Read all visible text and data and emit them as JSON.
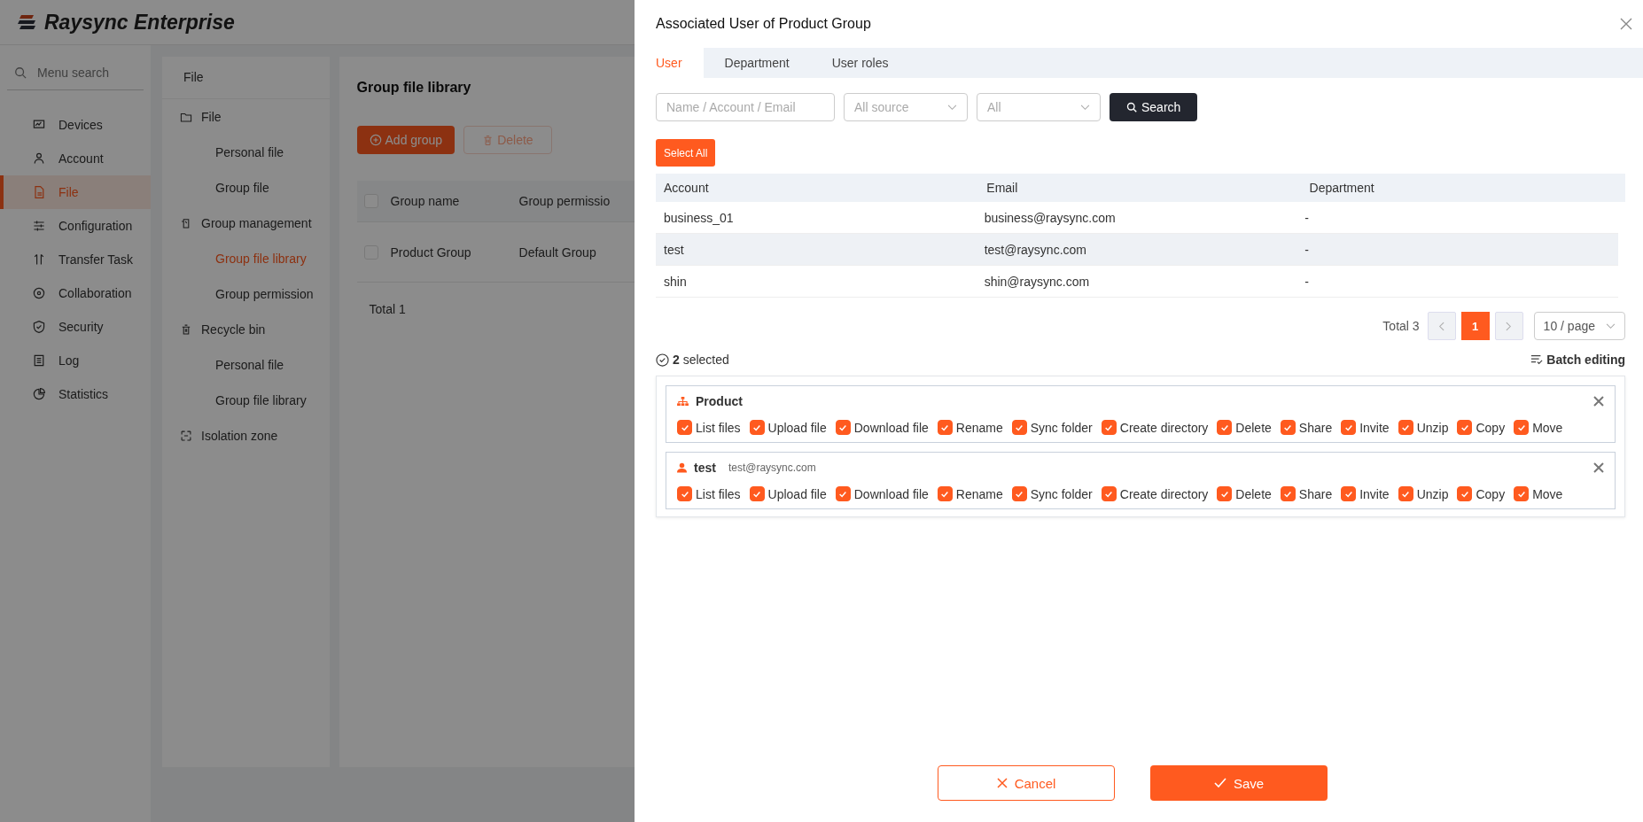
{
  "app": {
    "logo": "Raysync Enterprise",
    "menu_search": {
      "placeholder": "Menu search"
    },
    "menu": [
      {
        "label": "Devices",
        "selected": false
      },
      {
        "label": "Account",
        "selected": false
      },
      {
        "label": "File",
        "selected": true
      },
      {
        "label": "Configuration",
        "selected": false
      },
      {
        "label": "Transfer Task",
        "selected": false
      },
      {
        "label": "Collaboration",
        "selected": false
      },
      {
        "label": "Security",
        "selected": false
      },
      {
        "label": "Log",
        "selected": false
      },
      {
        "label": "Statistics",
        "selected": false
      }
    ],
    "subnav": {
      "title": "File",
      "groups": [
        {
          "label": "File",
          "children": [
            {
              "label": "Personal file",
              "selected": false
            },
            {
              "label": "Group file",
              "selected": false
            }
          ]
        },
        {
          "label": "Group management",
          "children": [
            {
              "label": "Group file library",
              "selected": true
            },
            {
              "label": "Group permission",
              "selected": false
            }
          ]
        },
        {
          "label": "Recycle bin",
          "children": [
            {
              "label": "Personal file",
              "selected": false
            },
            {
              "label": "Group file library",
              "selected": false
            }
          ]
        },
        {
          "label": "Isolation zone"
        }
      ]
    },
    "main": {
      "title": "Group file library",
      "buttons": [
        {
          "label": "Add group",
          "kind": "primary",
          "disabled": false
        },
        {
          "label": "Delete",
          "kind": "danger",
          "disabled": true
        }
      ],
      "table": {
        "header_checked": false,
        "columns": [
          "Group name",
          "Group permissio"
        ],
        "rows": [
          {
            "checked": false,
            "cells": [
              "Product Group",
              "Default Group"
            ]
          }
        ]
      },
      "total": "Total 1"
    }
  },
  "drawer": {
    "title": "Associated User of Product Group",
    "tabs": [
      {
        "label": "User",
        "selected": true
      },
      {
        "label": "Department",
        "selected": false
      },
      {
        "label": "User roles",
        "selected": false
      }
    ],
    "filters": {
      "search": {
        "placeholder": "Name / Account / Email"
      },
      "source": {
        "placeholder": "All source"
      },
      "status": {
        "placeholder": "All"
      },
      "search_button": "Search"
    },
    "select_all": "Select All",
    "table": {
      "columns": [
        "Account",
        "Email",
        "Department"
      ],
      "rows": [
        {
          "cells": [
            "business_01",
            "business@raysync.com",
            "-"
          ],
          "selected": false
        },
        {
          "cells": [
            "test",
            "test@raysync.com",
            "-"
          ],
          "selected": true
        },
        {
          "cells": [
            "shin",
            "shin@raysync.com",
            "-"
          ],
          "selected": false
        }
      ]
    },
    "pagination": {
      "total": "Total 3",
      "pages": [
        {
          "label": "1",
          "selected": true
        }
      ],
      "page_size": "10 / page"
    },
    "selected_summary": "**2** selected",
    "batch_editing": "Batch editing",
    "assignments": [
      {
        "kind": "department",
        "name": "Product",
        "permissions": [
          {
            "label": "List files",
            "checked": true
          },
          {
            "label": "Upload file",
            "checked": true
          },
          {
            "label": "Download file",
            "checked": true
          },
          {
            "label": "Rename",
            "checked": true
          },
          {
            "label": "Sync folder",
            "checked": true
          },
          {
            "label": "Create directory",
            "checked": true
          },
          {
            "label": "Delete",
            "checked": true
          },
          {
            "label": "Share",
            "checked": true
          },
          {
            "label": "Invite",
            "checked": true
          },
          {
            "label": "Unzip",
            "checked": true
          },
          {
            "label": "Copy",
            "checked": true
          },
          {
            "label": "Move",
            "checked": true
          }
        ]
      },
      {
        "kind": "user",
        "name": "test",
        "email": "test@raysync.com",
        "permissions": [
          {
            "label": "List files",
            "checked": true
          },
          {
            "label": "Upload file",
            "checked": true
          },
          {
            "label": "Download file",
            "checked": true
          },
          {
            "label": "Rename",
            "checked": true
          },
          {
            "label": "Sync folder",
            "checked": true
          },
          {
            "label": "Create directory",
            "checked": true
          },
          {
            "label": "Delete",
            "checked": true
          },
          {
            "label": "Share",
            "checked": true
          },
          {
            "label": "Invite",
            "checked": true
          },
          {
            "label": "Unzip",
            "checked": true
          },
          {
            "label": "Copy",
            "checked": true
          },
          {
            "label": "Move",
            "checked": true
          }
        ]
      }
    ],
    "actions": [
      {
        "label": "Cancel",
        "kind": "secondary"
      },
      {
        "label": "Save",
        "kind": "primary"
      }
    ]
  }
}
